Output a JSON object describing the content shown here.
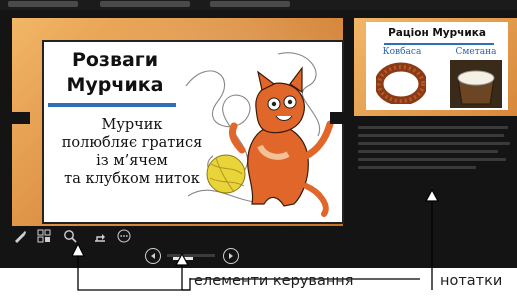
{
  "slide": {
    "title_line1": "Розваги",
    "title_line2": "Мурчика",
    "body_lines": [
      "Мурчик",
      "полюбляє гратися",
      "із м’ячем",
      "та клубком ниток"
    ]
  },
  "next_slide": {
    "title": "Раціон Мурчика",
    "item1": "Ковбаса",
    "item2": "Сметана"
  },
  "annotations": {
    "controls": "елементи керування",
    "notes": "нотатки"
  },
  "icons": [
    "pen-icon",
    "slides-grid-icon",
    "zoom-icon",
    "pointer-icon",
    "more-icon",
    "prev-arrow-icon",
    "next-arrow-icon"
  ],
  "colors": {
    "screen_bg": "#141414",
    "slide_frame_orange": "#d8883b",
    "title_underline_blue": "#2e6fb7",
    "food_label_blue": "#2a63a8"
  }
}
